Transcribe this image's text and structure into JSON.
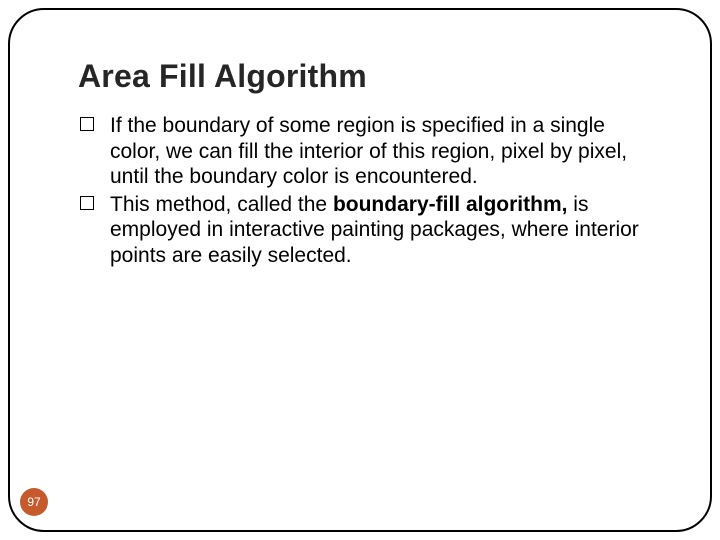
{
  "slide": {
    "title": "Area Fill Algorithm",
    "paragraphs": [
      {
        "leadin": "If the boundary of some region is specified in a single color, we can fill the interior of this region, pixel by pixel, until the boundary color is encountered."
      },
      {
        "leadin": "This method, called the ",
        "bold": "boundary-fill algorithm,",
        "tail": " is employed in interactive painting packages, where interior points are easily selected."
      }
    ],
    "page_number": "97"
  },
  "colors": {
    "badge_bg": "#c55a2c",
    "badge_fg": "#ffffff"
  }
}
